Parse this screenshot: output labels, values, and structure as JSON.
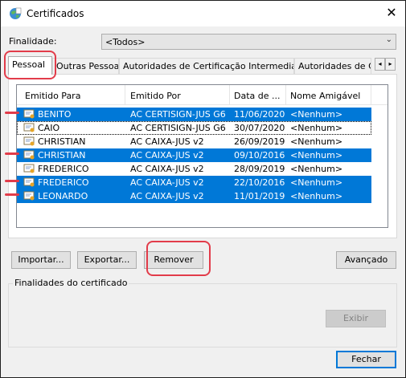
{
  "window": {
    "title": "Certificados",
    "close_glyph": "✕"
  },
  "purpose": {
    "label": "Finalidade:",
    "value": "<Todos>"
  },
  "tabs": [
    {
      "label": "Pessoal"
    },
    {
      "label": "Outras Pessoas"
    },
    {
      "label": "Autoridades de Certificação Intermediárias"
    },
    {
      "label": "Autoridades de Ce"
    }
  ],
  "tab_scroll": {
    "left": "◂",
    "right": "▸"
  },
  "columns": [
    "Emitido Para",
    "Emitido Por",
    "Data de ...",
    "Nome Amigável"
  ],
  "rows": [
    {
      "to": "BENITO",
      "by": "AC CERTISIGN-JUS G6",
      "date": "11/06/2020",
      "name": "<Nenhum>"
    },
    {
      "to": "CAIO",
      "by": "AC CERTISIGN-JUS G6",
      "date": "30/07/2020",
      "name": "<Nenhum>"
    },
    {
      "to": "CHRISTIAN",
      "by": "AC CAIXA-JUS v2",
      "date": "26/09/2019",
      "name": "<Nenhum>"
    },
    {
      "to": "CHRISTIAN",
      "by": "AC CAIXA-JUS v2",
      "date": "09/10/2016",
      "name": "<Nenhum>"
    },
    {
      "to": "FREDERICO",
      "by": "AC CAIXA-JUS v2",
      "date": "28/09/2019",
      "name": "<Nenhum>"
    },
    {
      "to": "FREDERICO",
      "by": "AC CAIXA-JUS v2",
      "date": "22/10/2016",
      "name": "<Nenhum>"
    },
    {
      "to": "LEONARDO",
      "by": "AC CAIXA-JUS v2",
      "date": "11/01/2019",
      "name": "<Nenhum>"
    }
  ],
  "buttons": {
    "import": "Importar...",
    "export": "Exportar...",
    "remove": "Remover",
    "advanced": "Avançado",
    "view": "Exibir",
    "close": "Fechar"
  },
  "group": {
    "label": "Finalidades do certificado"
  },
  "colors": {
    "selection": "#0078d7",
    "annotation": "#e23c4a"
  }
}
